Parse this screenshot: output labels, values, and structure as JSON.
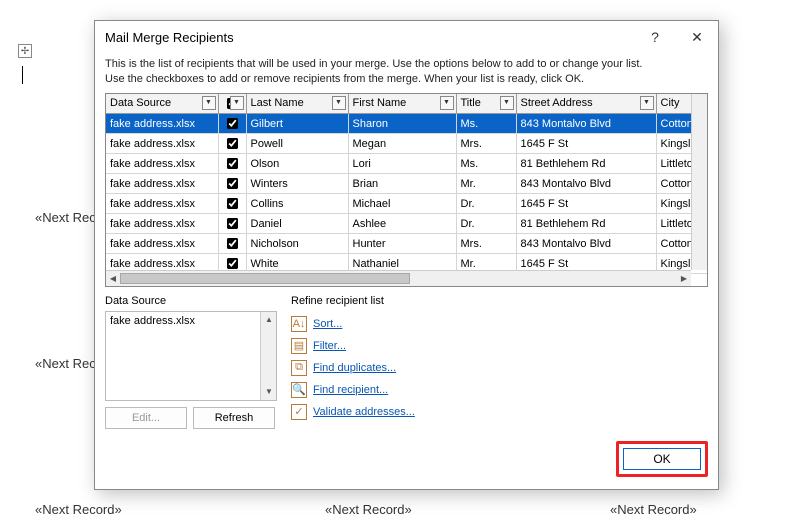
{
  "dialog": {
    "title": "Mail Merge Recipients",
    "instructions1": "This is the list of recipients that will be used in your merge.  Use the options below to add to or change your list.",
    "instructions2": "Use the checkboxes to add or remove recipients from the merge.  When your list is ready, click OK.",
    "help_glyph": "?",
    "close_glyph": "✕"
  },
  "columns": {
    "data_source": "Data Source",
    "last_name": "Last Name",
    "first_name": "First Name",
    "title": "Title",
    "street": "Street Address",
    "city": "City"
  },
  "rows": [
    {
      "ds": "fake address.xlsx",
      "ck": true,
      "ln": "Gilbert",
      "fn": "Sharon",
      "ti": "Ms.",
      "sa": "843 Montalvo Blvd",
      "ci": "Cottonwood",
      "sel": true
    },
    {
      "ds": "fake address.xlsx",
      "ck": true,
      "ln": "Powell",
      "fn": "Megan",
      "ti": "Mrs.",
      "sa": "1645 F St",
      "ci": "Kingsland"
    },
    {
      "ds": "fake address.xlsx",
      "ck": true,
      "ln": "Olson",
      "fn": "Lori",
      "ti": "Ms.",
      "sa": "81 Bethlehem Rd",
      "ci": "Littleton"
    },
    {
      "ds": "fake address.xlsx",
      "ck": true,
      "ln": "Winters",
      "fn": "Brian",
      "ti": "Mr.",
      "sa": "843 Montalvo Blvd",
      "ci": "Cottonwood"
    },
    {
      "ds": "fake address.xlsx",
      "ck": true,
      "ln": "Collins",
      "fn": "Michael",
      "ti": "Dr.",
      "sa": "1645 F St",
      "ci": "Kingsland"
    },
    {
      "ds": "fake address.xlsx",
      "ck": true,
      "ln": "Daniel",
      "fn": "Ashlee",
      "ti": "Dr.",
      "sa": "81 Bethlehem Rd",
      "ci": "Littleton"
    },
    {
      "ds": "fake address.xlsx",
      "ck": true,
      "ln": "Nicholson",
      "fn": "Hunter",
      "ti": "Mrs.",
      "sa": "843 Montalvo Blvd",
      "ci": "Cottonwood"
    },
    {
      "ds": "fake address.xlsx",
      "ck": true,
      "ln": "White",
      "fn": "Nathaniel",
      "ti": "Mr.",
      "sa": "1645 F St",
      "ci": "Kingsland"
    }
  ],
  "data_source_section": {
    "legend": "Data Source",
    "items": [
      "fake address.xlsx"
    ],
    "edit": "Edit...",
    "refresh": "Refresh"
  },
  "refine": {
    "legend": "Refine recipient list",
    "sort": "Sort...",
    "filter": "Filter...",
    "dupes": "Find duplicates...",
    "find": "Find recipient...",
    "validate": "Validate addresses..."
  },
  "ok_label": "OK",
  "dropdown_glyph": "▼",
  "bg_label": "«Next Record»",
  "anchor_glyph": "✢"
}
